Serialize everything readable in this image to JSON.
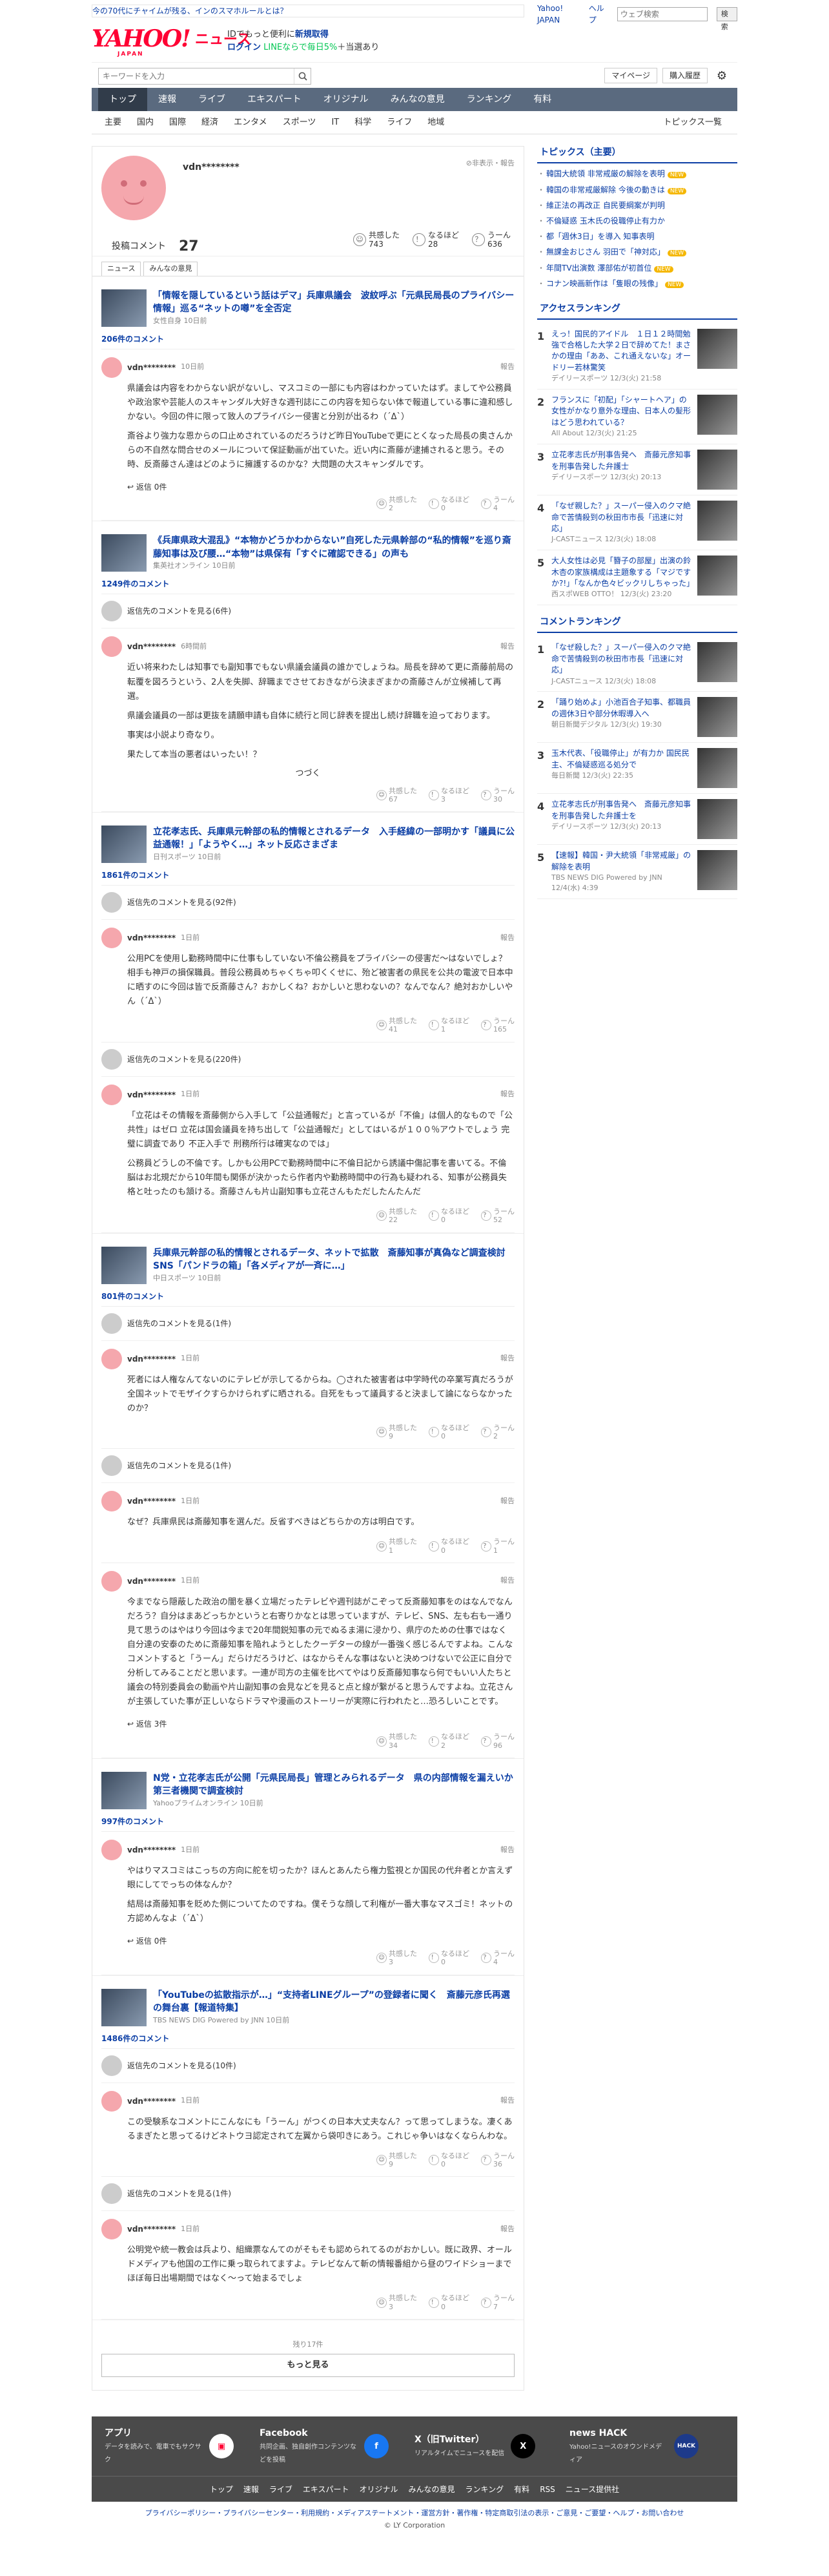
{
  "topbar": {
    "promo": "今の70代にチャイムが残る、インのスマホルールとは？",
    "yahoo_japan": "Yahoo! JAPAN",
    "help": "ヘルプ",
    "search_placeholder": "ウェブ検索",
    "submit": "検索"
  },
  "header": {
    "logo": "YAHOO!",
    "logo_jp": "JAPAN",
    "logo_news": "ニュース",
    "promo_l1": "IDでもっと便利に",
    "promo_l1b": "新規取得",
    "login": "ログイン",
    "promo_l2": "LINEならで毎日5%",
    "promo_l2b": "＋当選あり"
  },
  "search": {
    "placeholder": "キーワードを入力",
    "mypage": "マイページ",
    "purchase": "購入履歴"
  },
  "nav1": [
    "トップ",
    "速報",
    "ライブ",
    "エキスパート",
    "オリジナル",
    "みんなの意見",
    "ランキング",
    "有料"
  ],
  "nav2": [
    "主要",
    "国内",
    "国際",
    "経済",
    "エンタメ",
    "スポーツ",
    "IT",
    "科学",
    "ライフ",
    "地域"
  ],
  "nav2_right": "トピックス一覧",
  "profile": {
    "name": "vdn********",
    "report": "非表示・報告",
    "posts_label": "投稿コメント",
    "posts": "27",
    "stats": [
      {
        "label": "共感した",
        "value": "743"
      },
      {
        "label": "なるほど",
        "value": "28"
      },
      {
        "label": "うーん",
        "value": "636"
      }
    ],
    "tabs": [
      "ニュース",
      "みんなの意見"
    ]
  },
  "articles": [
    {
      "title": "「情報を隠しているという話はデマ」兵庫県議会　波紋呼ぶ「元県民局長のプライバシー情報」巡る“ネットの噂”を全否定",
      "source": "女性自身 10日前",
      "count": "206件のコメント",
      "comments": [
        {
          "user": "vdn********",
          "time": "10日前",
          "text": [
            "県議会は内容をわからない訳がないし、マスコミの一部にも内容はわかっていたはず。ましてや公務員や政治家や芸能人のスキャンダル大好きな週刊誌にこの内容を知らない体で報道している事に違和感しかない。今回の件に限って致人のプライバシー侵害と分別が出るわ（´Δ`）",
            "斎谷より強力な恩からの口止めされているのだろうけど昨日YouTubeで更にとくなった局長の奥さんからの不自然な問合せのメールについて保証動画が出ていた。近い内に斎藤が逮捕されると思う。その時、反斎藤さん達はどのように擁護するのかな？大問題の大スキャンダルです。"
          ],
          "reply": "返信 0件",
          "s": [
            "2",
            "0",
            "4"
          ]
        }
      ]
    },
    {
      "title": "《兵庫県政大混乱》“本物かどうかわからない”自死した元県幹部の“私的情報”を巡り斎藤知事は及び腰…“本物”は県保有「すぐに確認できる」の声も",
      "source": "集英社オンライン 10日前",
      "count": "1249件のコメント",
      "reply_link": "返信先のコメントを見る(6件)",
      "comments": [
        {
          "user": "vdn********",
          "time": "6時間前",
          "text": [
            "近い将来わたしは知事でも副知事でもない県議会議員の誰かでしょうね。局長を辞めて更に斎藤前局の転覆を図ろうという、2人を失脚、辞職までさせておきながら決まぎまかの斎藤さんが立候補して再選。",
            "県議会議員の一部は更抜を請願申請も自体に続行と同じ辞表を提出し続け辞職を迫っております。",
            "事実は小説より奇なり。",
            "果たして本当の悪者はいったい！？"
          ],
          "more": "つづく",
          "s": [
            "67",
            "3",
            "30"
          ]
        }
      ]
    },
    {
      "title": "立花孝志氏、兵庫県元幹部の私的情報とされるデータ　入手経緯の一部明かす「議員に公益通報！」「ようやく…」ネット反応さまざま",
      "source": "日刊スポーツ 10日前",
      "count": "1861件のコメント",
      "reply_link": "返信先のコメントを見る(92件)",
      "comments": [
        {
          "user": "vdn********",
          "time": "1日前",
          "text": [
            "公用PCを使用し勤務時間中に仕事もしていない不倫公務員をプライバシーの侵害だ〜はないでしょ？相手も神戸の損保職員。普段公務員めちゃくちゃ叩くくせに、殆ど被害者の県民を公共の電波で日本中に晒すのに今回は皆で反斎藤さん？おかしくね？おかしいと思わないの？なんでなん？絶対おかしいやん（´Δ`）"
          ],
          "s": [
            "41",
            "1",
            "165"
          ],
          "reply_link2": "返信先のコメントを見る(220件)"
        },
        {
          "user": "vdn********",
          "time": "1日前",
          "text": [
            "「立花はその情報を斎藤側から入手して「公益通報だ」と言っているが「不倫」は個人的なもので「公共性」はゼロ 立花は国会議員を持ち出して「公益通報だ」としてはいるが１００％アウトでしょう 完璧に調査であり 不正入手で 刑務所行は確実なのでは」",
            "公務員どうしの不倫です。しかも公用PCで勤務時間中に不倫日記から誘議中傷記事を書いてる。不倫脳はお北規だから10年間も関係が決かったら作者内や勤務時間中の行為も疑われる、知事が公務員失格と吐ったのも頷ける。斎藤さんも片山副知事も立花さんもただしたんたんだ"
          ],
          "s": [
            "22",
            "0",
            "52"
          ]
        }
      ]
    },
    {
      "title": "兵庫県元幹部の私的情報とされるデータ、ネットで拡散　斎藤知事が真偽など調査検討　SNS「パンドラの箱」「各メディアが一斉に…」",
      "source": "中日スポーツ 10日前",
      "count": "801件のコメント",
      "reply_link": "返信先のコメントを見る(1件)",
      "comments": [
        {
          "user": "vdn********",
          "time": "1日前",
          "text": [
            "死者には人権なんてないのにテレビが示してるからね。◯された被害者は中学時代の卒業写真だろうが全国ネットでモザイクすらかけられずに晒される。自死をもって議員すると決まして論にならなかったのか？"
          ],
          "s": [
            "9",
            "0",
            "2"
          ],
          "reply_link2": "返信先のコメントを見る(1件)"
        },
        {
          "user": "vdn********",
          "time": "1日前",
          "text": [
            "なぜ？兵庫県民は斎藤知事を選んだ。反省すべきはどちらかの方は明白です。"
          ],
          "s": [
            "1",
            "0",
            "1"
          ]
        },
        {
          "user": "vdn********",
          "time": "1日前",
          "text": [
            "今までなら隠蔽した政治の闇を暴く立場だったテレビや週刊誌がこぞって反斎藤知事をのはなんでなんだろう？自分はまあどっちかというと右寄りかなとは思っていますが、テレビ、SNS、左も右も一通り見て思うのはやはり今回は今まで20年間鋭知事の元でぬるま湯に浸かり、県庁のための仕事ではなく自分達の安泰のために斎藤知事を陥れようとしたクーデターの線が一番強く感じるんですよね。こんなコメントすると「うーん」だらけだろうけど、はなからそんな事はないと決めつけないで公正に自分で分析してみることだと思います。一連が司方の主催を比べてやはり反斎藤知事なら何でもいい人たちと議会の特別委員会の動画や片山副知事の会見などを見ると点と線が繋がると思うんですよね。立花さんが主張していた事が正しいならドラマや漫画のストーリーが実際に行われたと…恐ろしいことです。"
          ],
          "reply": "返信 3件",
          "s": [
            "34",
            "2",
            "96"
          ]
        }
      ]
    },
    {
      "title": "N党・立花孝志氏が公開「元県民局長」管理とみられるデータ　県の内部情報を漏えいか 第三者機関で調査検討",
      "source": "Yahooプライムオンライン 10日前",
      "count": "997件のコメント",
      "comments": [
        {
          "user": "vdn********",
          "time": "1日前",
          "text": [
            "やはりマスコミはこっちの方向に舵を切ったか？ほんとあんたら権力監視とか国民の代弁者とか言えず眼にしてでっちの体なんか？",
            "結局は斎藤知事を貶めた側についてたのですね。僕そうな顔して利権が一番大事なマスゴミ！ネットの方認めんなよ（´Δ`）"
          ],
          "reply": "返信 0件",
          "s": [
            "3",
            "0",
            "4"
          ]
        }
      ]
    },
    {
      "title": "「YouTubeの拡散指示が…」“支持者LINEグループ”の登録者に聞く　斎藤元彦氏再選の舞台裏【報道特集】",
      "source": "TBS NEWS DIG Powered by JNN 10日前",
      "count": "1486件のコメント",
      "reply_link": "返信先のコメントを見る(10件)",
      "comments": [
        {
          "user": "vdn********",
          "time": "1日前",
          "text": [
            "この受験系なコメントにこんなにも「うーん」がつくの日本大丈夫なん？って思ってしまうな。凄くあるまぎたと思ってるけどネトウヨ認定されて左翼から袋叩きにあう。これじゃ争いはなくならんわな。"
          ],
          "s": [
            "9",
            "0",
            "36"
          ],
          "reply_link2": "返信先のコメントを見る(1件)"
        },
        {
          "user": "vdn********",
          "time": "1日前",
          "text": [
            "公明党や統一教会は兵より、組織票なんてのがそもそも認められてるのがおかしい。既に政界、オールドメディアも他国の工作に乗っ取られてますよ。テレビなんて斬の情報番組から昼のワイドショーまでほぼ毎日出場期間ではなく〜って始まるでしょ"
          ],
          "s": [
            "3",
            "0",
            "7"
          ]
        }
      ]
    }
  ],
  "remain": "残り17件",
  "more_btn": "もっと見る",
  "topics": {
    "title": "トピックス（主要）",
    "items": [
      {
        "t": "韓国大統領 非常戒厳の解除を表明",
        "b": "NEW"
      },
      {
        "t": "韓国の非常戒厳解除 今後の動きは",
        "b": "NEW"
      },
      {
        "t": "維正法の再改正 自民要綱案が判明",
        "b": ""
      },
      {
        "t": "不倫疑惑 玉木氏の役職停止有力か",
        "b": ""
      },
      {
        "t": "都「週休3日」を導入 知事表明",
        "b": ""
      },
      {
        "t": "無課金おじさん 羽田で「神対応」",
        "b": "NEW"
      },
      {
        "t": "年間TV出演数 澤部佑が初首位",
        "b": "NEW"
      },
      {
        "t": "コナン映画新作は「隻眼の残像」",
        "b": "NEW"
      }
    ]
  },
  "access": {
    "title": "アクセスランキング",
    "items": [
      {
        "n": "1",
        "t": "えっ！国民的アイドル　１日１２時間勉強で合格した大学２日で辞めてた！まさかの理由「ああ、これ通えないな」オードリー若林驚笑",
        "s": "デイリースポーツ 12/3(火) 21:58"
      },
      {
        "n": "2",
        "t": "フランスに「初配」「シャートヘア」の女性がかなり意外な理由、日本人の髪形はどう思われている？",
        "s": "All About 12/3(火) 21:25"
      },
      {
        "n": "3",
        "t": "立花孝志氏が刑事告発へ　斎藤元彦知事を刑事告発した弁護士",
        "s": "デイリースポーツ 12/3(火) 20:13"
      },
      {
        "n": "4",
        "t": "「なぜ親した？」スーパー侵入のクマ絶命で苦情殺到の秋田市市長「迅速に対応」",
        "s": "J-CASTニュース 12/3(火) 18:08"
      },
      {
        "n": "5",
        "t": "大人女性は必見「簪子の部屋」出演の鈴木杏の家族構成は主題象する「マジですか?!」「なんか色々ビックリしちゃった」",
        "s": "西スポWEB OTTO！ 12/3(火) 23:20"
      }
    ]
  },
  "crank": {
    "title": "コメントランキング",
    "items": [
      {
        "n": "1",
        "t": "「なぜ殺した？」スーパー侵入のクマ絶命で苦情殺到の秋田市市長「迅速に対応」",
        "s": "J-CASTニュース 12/3(火) 18:08"
      },
      {
        "n": "2",
        "t": "「踊り始めよ」小池百合子知事、都職員の週休3日や部分休暇導入へ",
        "s": "朝日新聞デジタル 12/3(火) 19:30"
      },
      {
        "n": "3",
        "t": "玉木代表、「役職停止」が有力か 国民民主、不倫疑惑巡る処分で",
        "s": "毎日新聞 12/3(火) 22:35"
      },
      {
        "n": "4",
        "t": "立花孝志氏が刑事告発へ　斎藤元彦知事を刑事告発した弁護士を",
        "s": "デイリースポーツ 12/3(火) 20:13"
      },
      {
        "n": "5",
        "t": "【速報】韓国・尹大統領「非常戒厳」の解除を表明",
        "s": "TBS NEWS DIG Powered by JNN 12/4(水) 4:39"
      }
    ]
  },
  "footer": {
    "boxes": [
      {
        "t": "アプリ",
        "d": "データを読みで、電車でもサクサク"
      },
      {
        "t": "Facebook",
        "d": "共同企画、独自創作コンテンツなどを投稿"
      },
      {
        "t": "X（旧Twitter）",
        "d": "リアルタイムでニュースを配信"
      },
      {
        "t": "news HACK",
        "d": "Yahoo!ニュースのオウンドメディア"
      }
    ],
    "nav": [
      "トップ",
      "速報",
      "ライブ",
      "エキスパート",
      "オリジナル",
      "みんなの意見",
      "ランキング",
      "有料",
      "RSS",
      "ニュース提供社"
    ],
    "links": "プライバシーポリシー・プライバシーセンター・利用規約・メディアステートメント・運営方針・著作権・特定商取引法の表示・ご意見・ご要望・ヘルプ・お問い合わせ",
    "copy": "© LY Corporation"
  }
}
